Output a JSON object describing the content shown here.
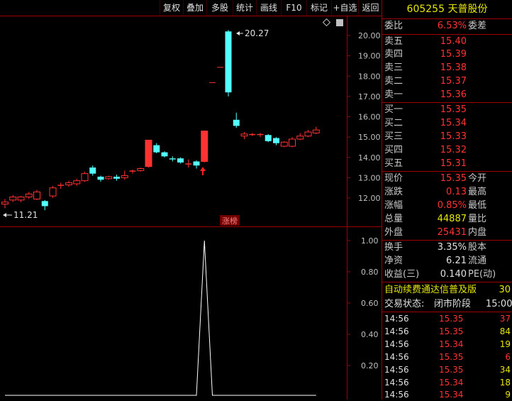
{
  "toolbar": [
    "复权",
    "叠加",
    "多股",
    "统计",
    "画线",
    "F10",
    "标记",
    "+自选",
    "返回"
  ],
  "header": {
    "code": "605255",
    "name": "天普股份"
  },
  "quote": {
    "weibi": {
      "label": "委比",
      "value": "6.53%",
      "label2": "委差"
    },
    "sell": [
      {
        "label": "卖五",
        "price": "15.40"
      },
      {
        "label": "卖四",
        "price": "15.39"
      },
      {
        "label": "卖三",
        "price": "15.38"
      },
      {
        "label": "卖二",
        "price": "15.37"
      },
      {
        "label": "卖一",
        "price": "15.36"
      }
    ],
    "buy": [
      {
        "label": "买一",
        "price": "15.35"
      },
      {
        "label": "买二",
        "price": "15.34"
      },
      {
        "label": "买三",
        "price": "15.33"
      },
      {
        "label": "买四",
        "price": "15.32"
      },
      {
        "label": "买五",
        "price": "15.31"
      }
    ],
    "stats": [
      {
        "label": "现价",
        "value": "15.35",
        "label2": "今开",
        "color": "red"
      },
      {
        "label": "涨跌",
        "value": "0.13",
        "label2": "最高",
        "color": "red"
      },
      {
        "label": "涨幅",
        "value": "0.85%",
        "label2": "最低",
        "color": "red"
      },
      {
        "label": "总量",
        "value": "44887",
        "label2": "量比",
        "color": "yel"
      },
      {
        "label": "外盘",
        "value": "25431",
        "label2": "内盘",
        "color": "red"
      }
    ],
    "fin": [
      {
        "label": "换手",
        "value": "3.35%",
        "label2": "股本"
      },
      {
        "label": "净资",
        "value": "6.21",
        "label2": "流通"
      },
      {
        "label": "收益(三)",
        "value": "0.140",
        "label2": "PE(动)"
      }
    ],
    "marquee": "自动续费通达信普及版",
    "marquee_tail": "30",
    "status_label": "交易状态:",
    "status_value": "闭市阶段",
    "status_time": "15:00:"
  },
  "trades": [
    {
      "time": "14:56",
      "price": "15.35",
      "vol": "37",
      "color": "red"
    },
    {
      "time": "14:56",
      "price": "15.35",
      "vol": "84",
      "color": "yel"
    },
    {
      "time": "14:56",
      "price": "15.34",
      "vol": "19",
      "color": "yel"
    },
    {
      "time": "14:56",
      "price": "15.35",
      "vol": "6",
      "color": "red"
    },
    {
      "time": "14:56",
      "price": "15.35",
      "vol": "34",
      "color": "yel"
    },
    {
      "time": "14:56",
      "price": "15.34",
      "vol": "18",
      "color": "yel"
    },
    {
      "time": "14:56",
      "price": "15.34",
      "vol": "9",
      "color": "yel"
    }
  ],
  "chart_data": {
    "type": "candlestick",
    "price_axis": {
      "ticks": [
        "20.00",
        "19.00",
        "18.00",
        "17.00",
        "16.00",
        "15.00",
        "14.00",
        "13.00",
        "12.00"
      ],
      "min": 11.0,
      "max": 20.6
    },
    "annotations": {
      "high": "20.27",
      "low": "11.21",
      "tag": "涨榜"
    },
    "candles": [
      {
        "o": 11.7,
        "c": 11.8,
        "h": 11.95,
        "l": 11.5
      },
      {
        "o": 11.9,
        "c": 12.05,
        "h": 12.15,
        "l": 11.8
      },
      {
        "o": 11.9,
        "c": 12.05,
        "h": 12.1,
        "l": 11.8
      },
      {
        "o": 12.05,
        "c": 12.2,
        "h": 12.3,
        "l": 11.95
      },
      {
        "o": 11.95,
        "c": 12.3,
        "h": 12.4,
        "l": 11.9
      },
      {
        "o": 11.85,
        "c": 11.6,
        "h": 11.9,
        "l": 11.4
      },
      {
        "o": 12.1,
        "c": 12.5,
        "h": 12.6,
        "l": 12.0
      },
      {
        "o": 12.6,
        "c": 12.65,
        "h": 12.75,
        "l": 12.45
      },
      {
        "o": 12.65,
        "c": 12.75,
        "h": 12.85,
        "l": 12.55
      },
      {
        "o": 12.7,
        "c": 12.85,
        "h": 12.95,
        "l": 12.6
      },
      {
        "o": 12.85,
        "c": 13.2,
        "h": 13.3,
        "l": 12.8
      },
      {
        "o": 13.5,
        "c": 13.2,
        "h": 13.6,
        "l": 13.1
      },
      {
        "o": 13.05,
        "c": 12.9,
        "h": 13.1,
        "l": 12.8
      },
      {
        "o": 12.95,
        "c": 13.05,
        "h": 13.1,
        "l": 12.9
      },
      {
        "o": 13.05,
        "c": 12.95,
        "h": 13.15,
        "l": 12.85
      },
      {
        "o": 13.0,
        "c": 13.1,
        "h": 13.35,
        "l": 12.9
      },
      {
        "o": 13.3,
        "c": 13.35,
        "h": 13.4,
        "l": 13.2
      },
      {
        "o": 13.35,
        "c": 13.45,
        "h": 13.5,
        "l": 13.3
      },
      {
        "o": 13.55,
        "c": 14.85,
        "h": 14.85,
        "l": 13.5
      },
      {
        "o": 14.6,
        "c": 14.25,
        "h": 14.7,
        "l": 14.2
      },
      {
        "o": 14.25,
        "c": 14.05,
        "h": 14.3,
        "l": 14.0
      },
      {
        "o": 13.95,
        "c": 13.9,
        "h": 14.05,
        "l": 13.8
      },
      {
        "o": 13.95,
        "c": 13.75,
        "h": 14.0,
        "l": 13.7
      },
      {
        "o": 13.65,
        "c": 13.7,
        "h": 13.9,
        "l": 13.5
      },
      {
        "o": 13.8,
        "c": 13.6,
        "h": 13.85,
        "l": 13.45
      },
      {
        "o": 13.8,
        "c": 15.3,
        "h": 15.3,
        "l": 13.75
      },
      {
        "o": 17.7,
        "c": 17.7,
        "h": 17.7,
        "l": 17.7
      },
      {
        "o": 18.45,
        "c": 18.45,
        "h": 18.45,
        "l": 18.45
      },
      {
        "o": 20.2,
        "c": 17.2,
        "h": 20.27,
        "l": 17.0
      },
      {
        "o": 15.85,
        "c": 15.55,
        "h": 16.2,
        "l": 15.45
      },
      {
        "o": 15.05,
        "c": 15.15,
        "h": 15.25,
        "l": 14.9
      },
      {
        "o": 15.1,
        "c": 15.15,
        "h": 15.2,
        "l": 15.05
      },
      {
        "o": 15.1,
        "c": 15.15,
        "h": 15.2,
        "l": 15.0
      },
      {
        "o": 15.1,
        "c": 14.8,
        "h": 15.15,
        "l": 14.75
      },
      {
        "o": 14.95,
        "c": 14.7,
        "h": 15.0,
        "l": 14.6
      },
      {
        "o": 14.55,
        "c": 14.75,
        "h": 14.8,
        "l": 14.5
      },
      {
        "o": 14.55,
        "c": 14.9,
        "h": 15.0,
        "l": 14.5
      },
      {
        "o": 14.9,
        "c": 15.05,
        "h": 15.2,
        "l": 14.85
      },
      {
        "o": 15.05,
        "c": 15.25,
        "h": 15.35,
        "l": 15.0
      },
      {
        "o": 15.2,
        "c": 15.35,
        "h": 15.5,
        "l": 15.15
      }
    ],
    "indicator": {
      "ticks": [
        "1.00",
        "0.80",
        "0.60",
        "0.40",
        "0.20"
      ],
      "min": 0.0,
      "max": 1.0,
      "values": [
        0,
        0,
        0,
        0,
        0,
        0,
        0,
        0,
        0,
        0,
        0,
        0,
        0,
        0,
        0,
        0,
        0,
        0,
        0,
        0,
        0,
        0,
        0,
        0,
        0,
        1.0,
        0,
        0,
        0,
        0,
        0,
        0,
        0,
        0,
        0,
        0,
        0,
        0,
        0,
        0
      ]
    }
  }
}
